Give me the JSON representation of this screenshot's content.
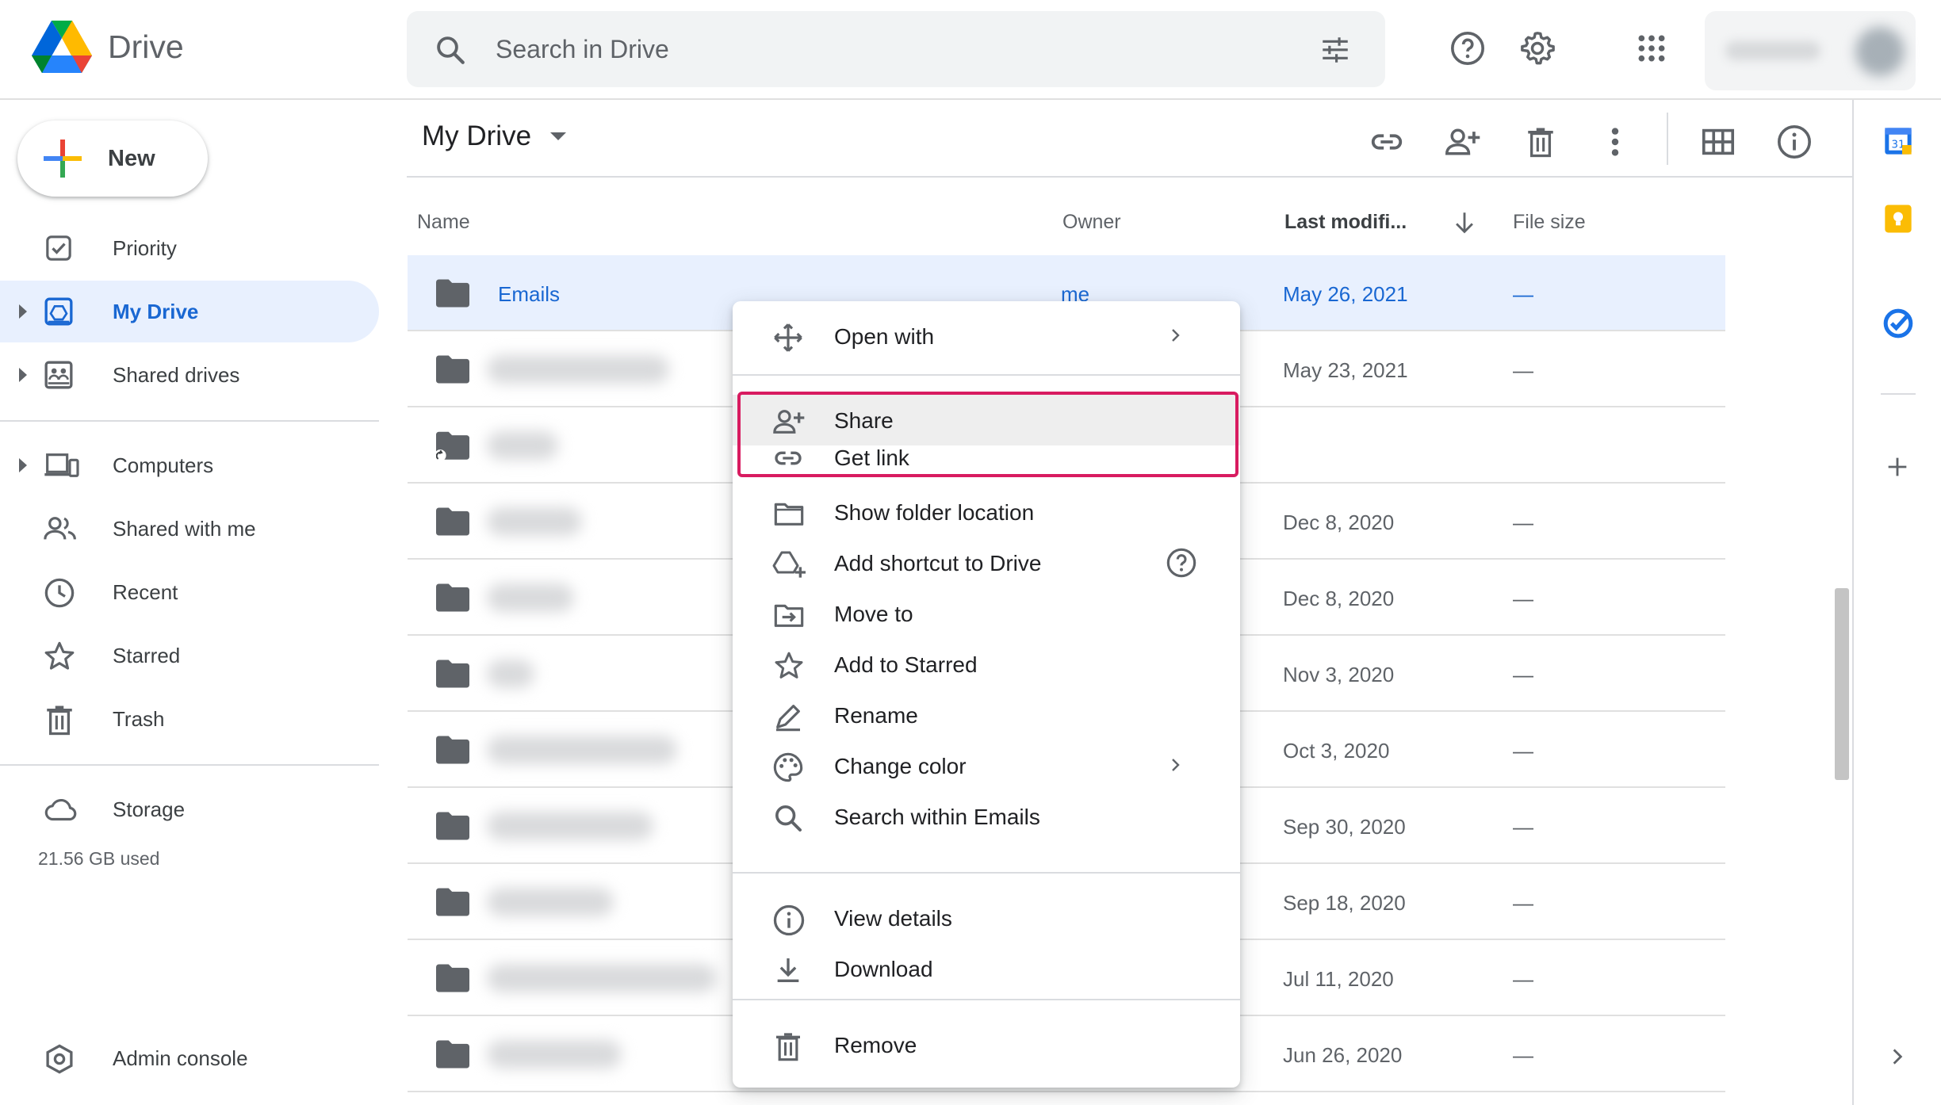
{
  "app": {
    "name": "Drive"
  },
  "search": {
    "placeholder": "Search in Drive"
  },
  "new_button": {
    "label": "New"
  },
  "sidebar": {
    "items": [
      {
        "label": "Priority",
        "icon": "priority-icon"
      },
      {
        "label": "My Drive",
        "icon": "my-drive-icon",
        "active": true
      },
      {
        "label": "Shared drives",
        "icon": "shared-drives-icon"
      },
      {
        "label": "Computers",
        "icon": "computers-icon"
      },
      {
        "label": "Shared with me",
        "icon": "shared-with-me-icon"
      },
      {
        "label": "Recent",
        "icon": "recent-icon"
      },
      {
        "label": "Starred",
        "icon": "star-icon"
      },
      {
        "label": "Trash",
        "icon": "trash-icon"
      }
    ],
    "storage": {
      "label": "Storage",
      "used": "21.56 GB used"
    },
    "admin": {
      "label": "Admin console"
    }
  },
  "main": {
    "title": "My Drive",
    "columns": {
      "name": "Name",
      "owner": "Owner",
      "modified": "Last modifi...",
      "size": "File size"
    },
    "rows": [
      {
        "name": "Emails",
        "owner": "me",
        "modified": "May 26, 2021",
        "size": "—",
        "selected": true
      },
      {
        "name": "",
        "owner": "",
        "modified": "May 23, 2021",
        "size": "—"
      },
      {
        "name": "",
        "owner": "",
        "modified": "",
        "size": "",
        "shortcut": true
      },
      {
        "name": "",
        "owner": "",
        "modified": "Dec 8, 2020",
        "size": "—"
      },
      {
        "name": "",
        "owner": "",
        "modified": "Dec 8, 2020",
        "size": "—"
      },
      {
        "name": "",
        "owner": "",
        "modified": "Nov 3, 2020",
        "size": "—"
      },
      {
        "name": "",
        "owner": "",
        "modified": "Oct 3, 2020",
        "size": "—"
      },
      {
        "name": "",
        "owner": "",
        "modified": "Sep 30, 2020",
        "size": "—"
      },
      {
        "name": "",
        "owner": "",
        "modified": "Sep 18, 2020",
        "size": "—"
      },
      {
        "name": "",
        "owner": "",
        "modified": "Jul 11, 2020",
        "size": "—"
      },
      {
        "name": "",
        "owner": "",
        "modified": "Jun 26, 2020",
        "size": "—"
      }
    ]
  },
  "context_menu": {
    "items": [
      {
        "label": "Open with",
        "icon": "open-with-icon"
      },
      {
        "label": "Share",
        "icon": "share-icon"
      },
      {
        "label": "Get link",
        "icon": "link-icon"
      },
      {
        "label": "Show folder location",
        "icon": "folder-outline-icon"
      },
      {
        "label": "Add shortcut to Drive",
        "icon": "add-shortcut-icon"
      },
      {
        "label": "Move to",
        "icon": "move-to-icon"
      },
      {
        "label": "Add to Starred",
        "icon": "star-icon"
      },
      {
        "label": "Rename",
        "icon": "rename-icon"
      },
      {
        "label": "Change color",
        "icon": "palette-icon"
      },
      {
        "label": "Search within Emails",
        "icon": "search-icon"
      },
      {
        "label": "View details",
        "icon": "info-icon"
      },
      {
        "label": "Download",
        "icon": "download-icon"
      },
      {
        "label": "Remove",
        "icon": "trash-icon"
      }
    ]
  },
  "colors": {
    "accent": "#1967d2",
    "selected_bg": "#e8f0fe",
    "highlight_border": "#d81b60"
  }
}
